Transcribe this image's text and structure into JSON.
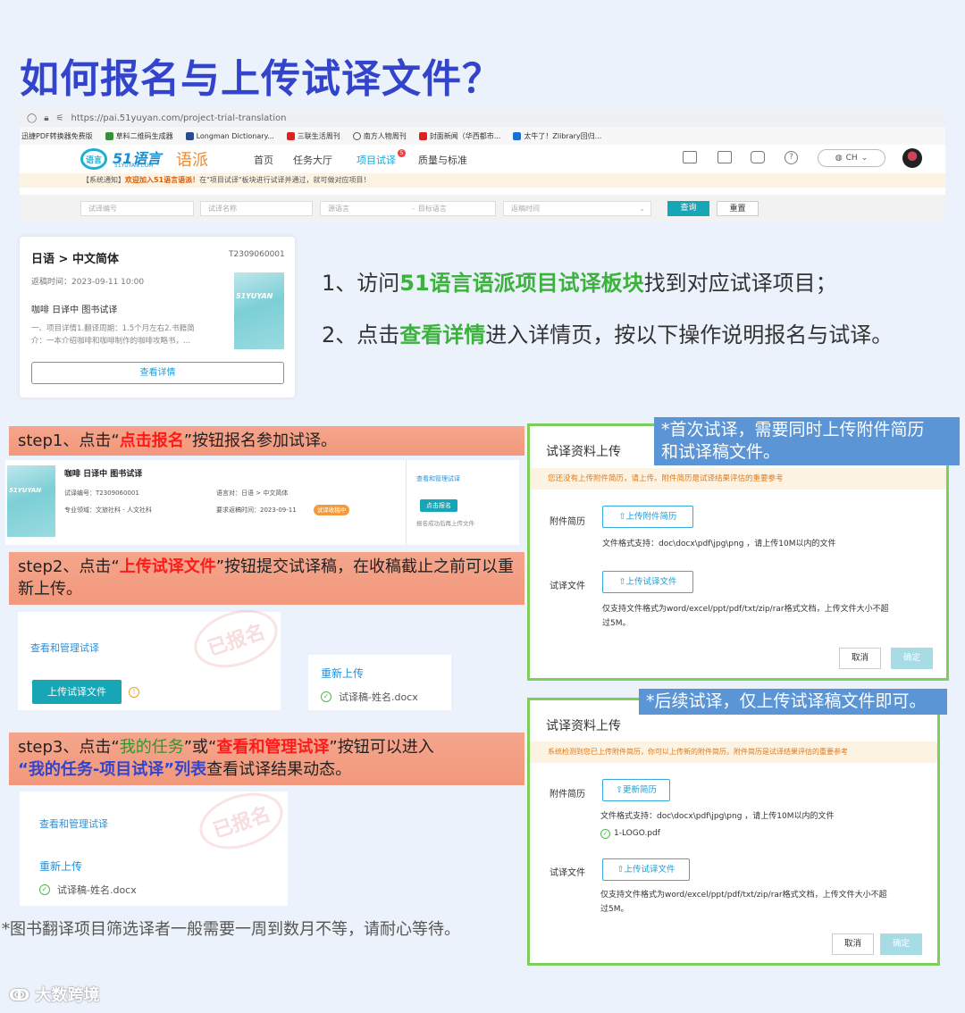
{
  "title": "如何报名与上传试译文件？",
  "browser": {
    "url": "https://pai.51yuyan.com/project-trial-translation",
    "bookmarks": [
      "迅捷PDF转换器免费版",
      "草料二维码生成器",
      "Longman Dictionary...",
      "三联生活周刊",
      "南方人物周刊",
      "封面新闻（华西都市...",
      "太牛了！Zlibrary回归..."
    ]
  },
  "site": {
    "logo_mark": "语言",
    "logo_name": "51语言",
    "logo_sub": "51YUYAN.COM",
    "logo_brand": "语派",
    "nav": [
      "首页",
      "任务大厅",
      "项目试译",
      "质量与标准"
    ],
    "nav_badge": "5",
    "lang": "CH",
    "notice_prefix": "【系统通知】",
    "notice_highlight": "欢迎加入51语言语派！",
    "notice_text": "在\"项目试译\"板块进行试译并通过，就可做对应项目！",
    "filters": {
      "code": "试译编号",
      "name": "试译名称",
      "source": "源语言",
      "dash": "-",
      "target": "目标语言",
      "time": "返稿时间",
      "search": "查询",
      "reset": "重置"
    }
  },
  "card": {
    "pair": "日语 > 中文简体",
    "id": "T2309060001",
    "return_time": "返稿时间：2023-09-11 10:00",
    "name": "咖啡 日译中 图书试译",
    "desc1": "一、项目详情1.翻译周期：1.5个月左右2.书籍简",
    "desc2": "介：一本介绍咖啡和咖啡制作的咖啡攻略书，...",
    "cover_label": "51YUYAN",
    "button": "查看详情"
  },
  "instructions": {
    "line1": {
      "pre": "1、访问",
      "hl": "51语言语派项目试译板块",
      "post": "找到对应试译项目；"
    },
    "line2": {
      "pre": "2、点击",
      "hl": "查看详情",
      "post": "进入详情页，按以下操作说明报名与试译。"
    }
  },
  "step1": {
    "pre": "step1、点击“",
    "hl": "点击报名",
    "post": "”按钮报名参加试译。",
    "shot": {
      "name": "咖啡 日译中 图书试译",
      "code": "试译编号：T2309060001",
      "field": "专业领域：文旅社科 - 人文社科",
      "pair": "语言对：日语 > 中文简体",
      "return": "要求返稿时间：2023-09-11",
      "tag": "试译收稿中",
      "manage": "查看和管理试译",
      "signup": "点击报名",
      "after": "报名成功后再上传文件",
      "cover_label": "51YUYAN"
    }
  },
  "step2": {
    "pre": "step2、点击“",
    "hl": "上传试译文件",
    "post": "”按钮提交试译稿，在收稿截止之前可以重新上传。",
    "stamp": "已报名",
    "manage": "查看和管理试译",
    "upload": "上传试译文件",
    "reupload": "重新上传",
    "file": "试译稿-姓名.docx"
  },
  "step3": {
    "pre": "step3、点击“",
    "hl1": "我的任务",
    "mid": "”或“",
    "hl2": "查看和管理试译",
    "post": "”按钮可以进入",
    "hl3": "“我的任务-项目试译”列表",
    "post2": "查看试译结果动态。",
    "stamp": "已报名",
    "manage": "查看和管理试译",
    "reupload": "重新上传",
    "file": "试译稿-姓名.docx"
  },
  "dialog1": {
    "callout": "*首次试译，需要同时上传附件简历和试译稿文件。",
    "callout_l1": "*首次试译，需要同时上传附件简历",
    "callout_l2": "和试译稿文件。",
    "title": "试译资料上传",
    "warn": "您还没有上传附件简历，请上传。附件简历是试译结果评估的重要参考",
    "resume_label": "附件简历",
    "resume_btn": "上传附件简历",
    "resume_fmt": "文件格式支持：doc\\docx\\pdf\\jpg\\png ，请上传10M以内的文件",
    "trans_label": "试译文件",
    "trans_btn": "上传试译文件",
    "trans_fmt1": "仅支持文件格式为word/excel/ppt/pdf/txt/zip/rar格式文档，上传文件大小不超",
    "trans_fmt2": "过5M。",
    "cancel": "取消",
    "ok": "确定"
  },
  "dialog2": {
    "callout": "*后续试译，仅上传试译稿文件即可。",
    "title": "试译资料上传",
    "warn": "系统检测到您已上传附件简历，你可以上传新的附件简历。附件简历是试译结果评估的重要参考",
    "resume_label": "附件简历",
    "resume_btn": "更新简历",
    "resume_fmt": "文件格式支持：doc\\docx\\pdf\\jpg\\png ，请上传10M以内的文件",
    "resume_file": "1-LOGO.pdf",
    "trans_label": "试译文件",
    "trans_btn": "上传试译文件",
    "trans_fmt1": "仅支持文件格式为word/excel/ppt/pdf/txt/zip/rar格式文档，上传文件大小不超",
    "trans_fmt2": "过5M。",
    "cancel": "取消",
    "ok": "确定"
  },
  "footnote": "*图书翻译项目筛选译者一般需要一周到数月不等，请耐心等待。",
  "watermark": "大数跨境",
  "colors": {
    "title": "#3344cc",
    "accent_green": "#3bb23b",
    "step_bg": "#f2987c",
    "callout_bg": "#5b95d6",
    "dialog_border": "#7ccf5a",
    "teal": "#16a6b6"
  }
}
